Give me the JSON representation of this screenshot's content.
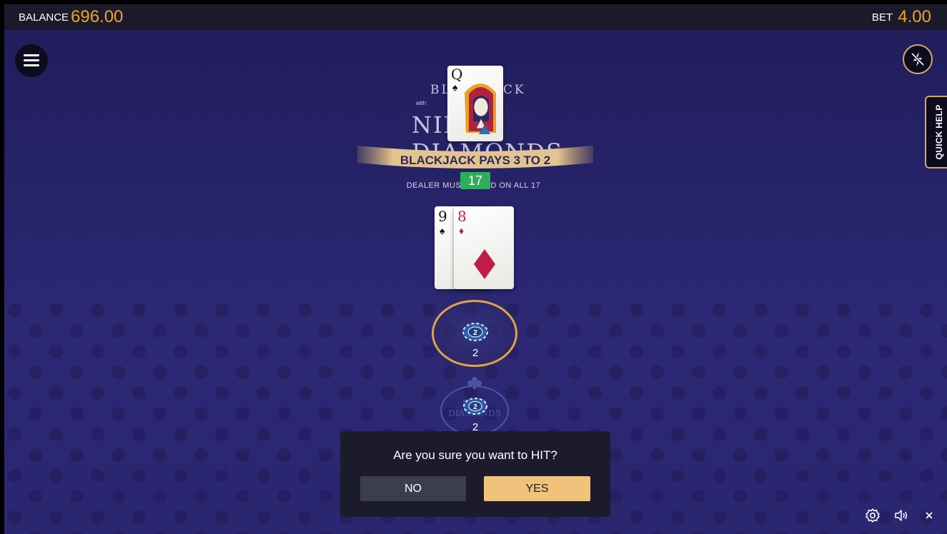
{
  "header": {
    "balance_label": "BALANCE",
    "balance_value": "696.00",
    "bet_label": "BET",
    "bet_value": "4.00"
  },
  "side": {
    "quick_help": "QUICK HELP"
  },
  "logo": {
    "line1": "BLACKJACK",
    "line_small": "with",
    "line2": "NINE DIAMONDS",
    "trademark": "™"
  },
  "table": {
    "banner": "BLACKJACK PAYS 3 TO 2",
    "dealer_rule": "DEALER MUST STAND ON ALL 17"
  },
  "dealer": {
    "cards": [
      {
        "rank": "Q",
        "suit": "♠"
      }
    ]
  },
  "player": {
    "score": "17",
    "cards": [
      {
        "rank": "9",
        "suit": "♠",
        "color": "#111111"
      },
      {
        "rank": "8",
        "suit": "♦",
        "color": "#c01c4a"
      }
    ],
    "main_bet": "2",
    "side_bet": "2",
    "side_bet_label": "NINE DIAMONDS"
  },
  "chips": {
    "main_chip": "2",
    "side_chip": "2"
  },
  "dialog": {
    "question": "Are you sure you want to HIT?",
    "no_label": "NO",
    "yes_label": "YES"
  },
  "bottom": {
    "icons": [
      "settings-icon",
      "sound-icon",
      "close-icon"
    ]
  },
  "colors": {
    "accent": "#f2a21f",
    "gold_border": "#e2a43c",
    "score_green": "#2fae59",
    "yes_button": "#f0c27b",
    "background": "#262267"
  }
}
